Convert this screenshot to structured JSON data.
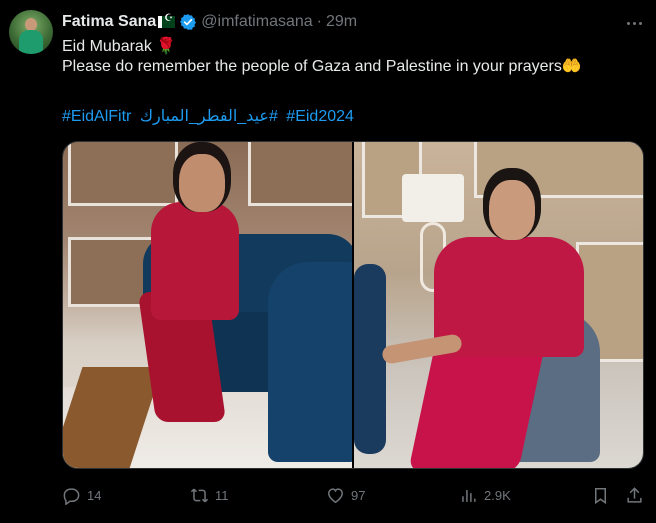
{
  "author": {
    "name": "Fatima Sana",
    "handle": "@imfatimasana",
    "separator": "·",
    "time": "29m",
    "flag_icon": "pakistan-flag-icon",
    "verified_icon": "verified-badge-icon"
  },
  "tweet": {
    "line1": "Eid Mubarak",
    "line1_emoji": "🌹",
    "line2": "Please do remember the people of Gaza and Palestine in your prayers",
    "line2_emoji": "🤲",
    "hashtags": [
      "#EidAlFitr",
      "#عيد_الفطر_المبارك",
      "#Eid2024"
    ]
  },
  "media": {
    "photos": [
      "photo-left",
      "photo-right"
    ]
  },
  "actions": {
    "reply": {
      "count": "14",
      "icon": "reply-icon"
    },
    "retweet": {
      "count": "11",
      "icon": "retweet-icon"
    },
    "like": {
      "count": "97",
      "icon": "heart-icon"
    },
    "views": {
      "count": "2.9K",
      "icon": "views-icon"
    },
    "bookmark": {
      "icon": "bookmark-icon"
    },
    "share": {
      "icon": "share-icon"
    }
  },
  "colors": {
    "background": "#000000",
    "text": "#e7e9ea",
    "muted": "#71767b",
    "link": "#1d9bf0",
    "verified": "#1d9bf0"
  }
}
